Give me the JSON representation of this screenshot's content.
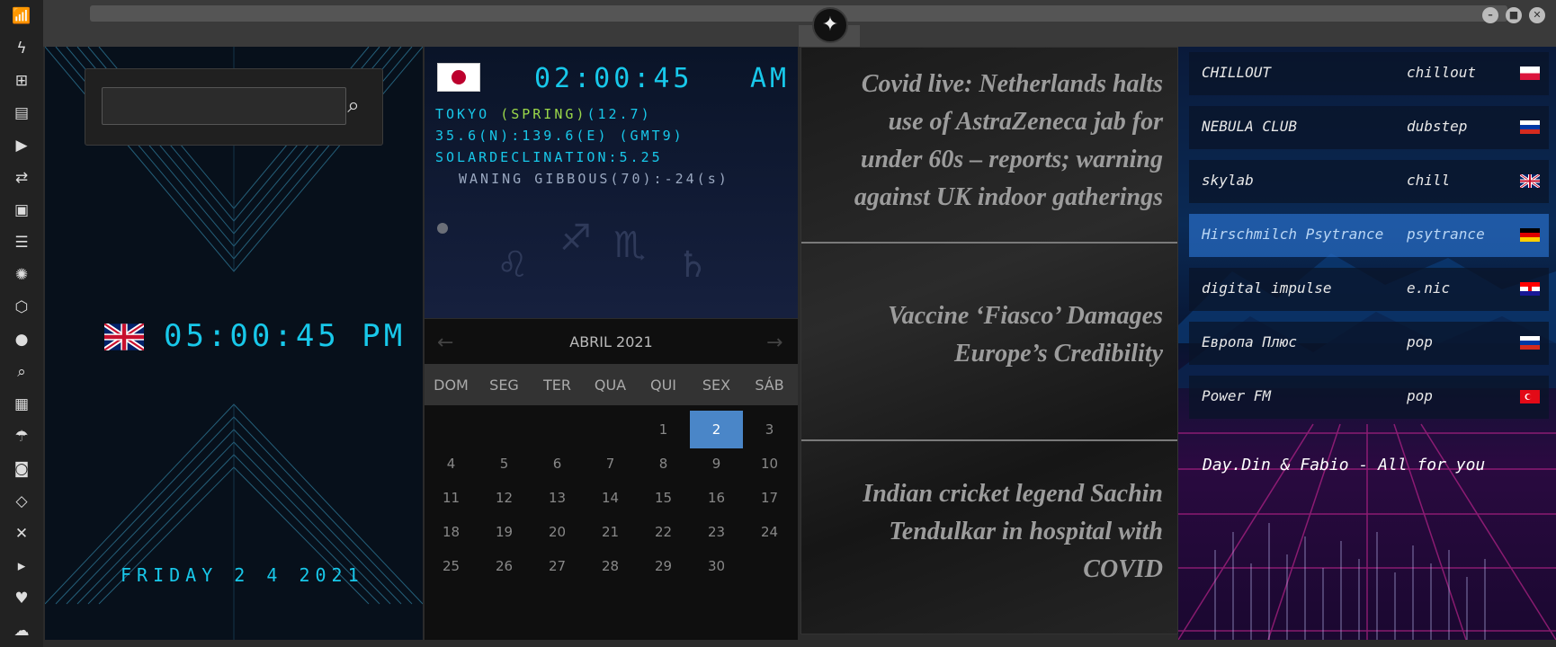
{
  "uk_clock": {
    "time": "05:00:45 PM",
    "date": "FRIDAY 2 4 2021"
  },
  "search": {
    "value": "",
    "placeholder": ""
  },
  "tokyo": {
    "time": "02:00:45",
    "ampm": "AM",
    "line1_prefix": "TOKYO ",
    "season": "(SPRING)",
    "line1_suffix": "(12.7)",
    "coords": "35.6(N):139.6(E) (GMT9)",
    "declination": "SOLARDECLINATION:5.25",
    "moon": "WANING GIBBOUS(70):-24(s)"
  },
  "calendar": {
    "month": "ABRIL 2021",
    "weekdays": [
      "DOM",
      "SEG",
      "TER",
      "QUA",
      "QUI",
      "SEX",
      "SÁB"
    ],
    "first_weekday": 4,
    "days_in_month": 30,
    "selected_day": 2
  },
  "news": [
    "Covid live: Netherlands halts use of AstraZeneca jab for under 60s – reports; warning against UK indoor gatherings",
    "Vaccine ‘Fiasco’ Damages Europe’s Credibility",
    "Indian cricket legend Sachin Tendulkar in hospital with COVID"
  ],
  "radio": {
    "stations": [
      {
        "name": "CHILLOUT",
        "genre": "chillout",
        "flag": "flag-pl"
      },
      {
        "name": "NEBULA CLUB",
        "genre": "dubstep",
        "flag": "flag-ru"
      },
      {
        "name": "skylab",
        "genre": "chill",
        "flag": "flag-uk"
      },
      {
        "name": "Hirschmilch Psytrance",
        "genre": "psytrance",
        "flag": "flag-de"
      },
      {
        "name": "digital impulse",
        "genre": "e.nic",
        "flag": "flag-hr"
      },
      {
        "name": "Европа Плюс",
        "genre": "pop",
        "flag": "flag-ru"
      },
      {
        "name": "Power FM",
        "genre": "pop",
        "flag": "flag-tr"
      }
    ],
    "active_index": 3,
    "now_playing": "Day.Din & Fabio - All for you"
  },
  "sidebar_icons": [
    "wifi-icon",
    "lightning-icon",
    "windows-icon",
    "archive-icon",
    "play-icon",
    "translate-icon",
    "image-icon",
    "news-icon",
    "radio-icon",
    "hexagon-icon",
    "globe-icon",
    "search-icon",
    "map-icon",
    "umbrella-icon",
    "contacts-icon",
    "code-icon",
    "fullscreen-icon",
    "youtube-icon",
    "heart-icon",
    "cloud-icon"
  ],
  "colors": {
    "lcd": "#18c8ea",
    "accent_green": "#9bd84a",
    "calendar_selected": "#4a86c8",
    "news_text": "#9c9c9c"
  }
}
